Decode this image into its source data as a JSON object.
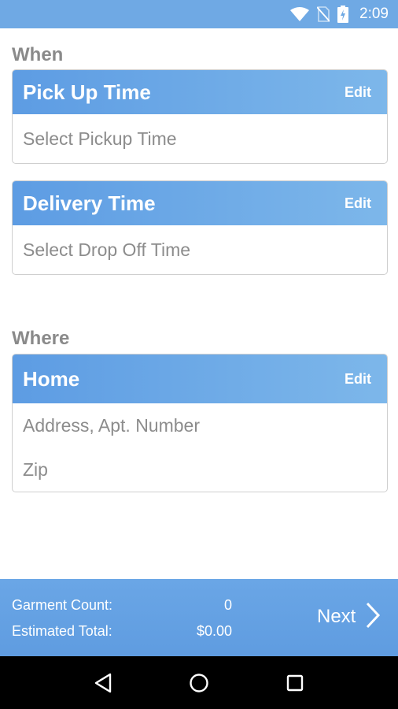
{
  "status_bar": {
    "time": "2:09",
    "icons": [
      "wifi-icon",
      "no-sim-icon",
      "battery-charging-icon"
    ]
  },
  "when": {
    "label": "When",
    "pickup": {
      "title": "Pick Up Time",
      "edit": "Edit",
      "placeholder": "Select Pickup Time"
    },
    "delivery": {
      "title": "Delivery Time",
      "edit": "Edit",
      "placeholder": "Select Drop Off Time"
    }
  },
  "where": {
    "label": "Where",
    "address": {
      "title": "Home",
      "edit": "Edit",
      "line1": "Address, Apt. Number",
      "zip": "Zip"
    }
  },
  "summary": {
    "garment_label": "Garment Count:",
    "garment_value": "0",
    "total_label": "Estimated Total:",
    "total_value": "$0.00",
    "next": "Next"
  },
  "nav": {
    "icons": [
      "back-icon",
      "home-icon",
      "recents-icon"
    ]
  },
  "colors": {
    "accent": "#6fa9e4",
    "header_start": "#5d9ce3",
    "header_end": "#7db7ea",
    "label_gray": "#8a8a8a"
  }
}
